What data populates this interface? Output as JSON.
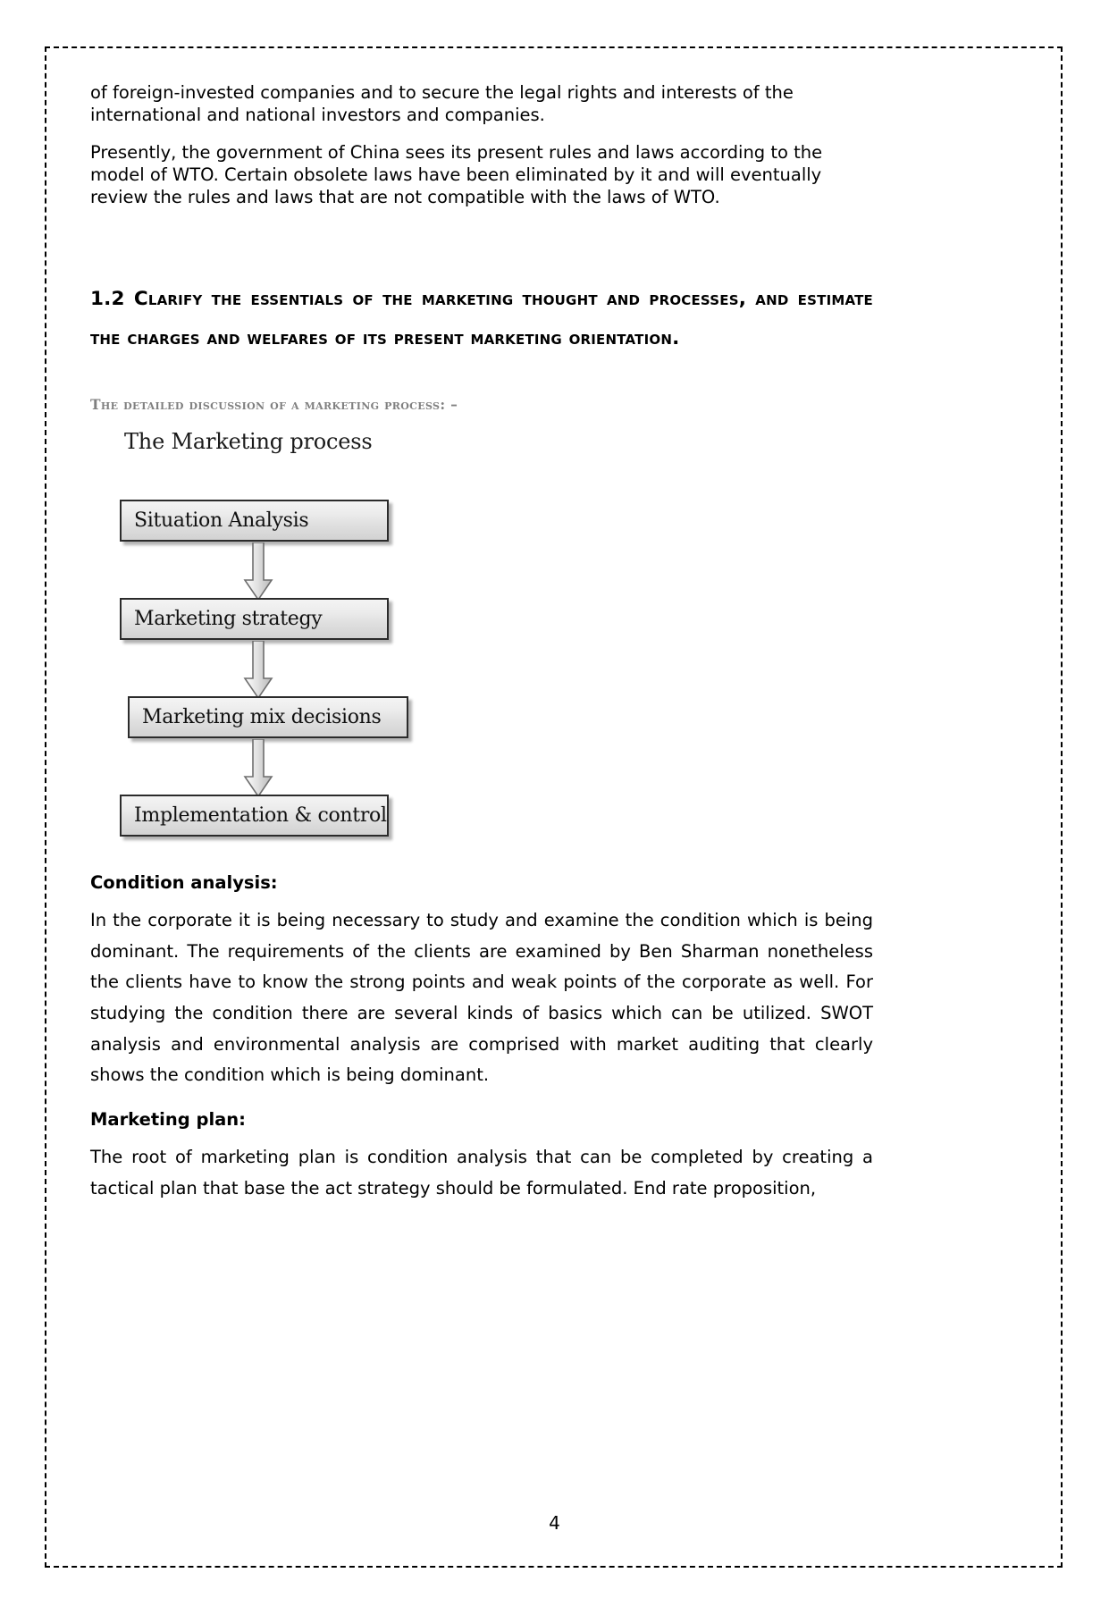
{
  "document": {
    "page_number": "4",
    "border_style": "dashed"
  },
  "paragraphs": {
    "p1": "of foreign-invested companies and to secure the legal rights and interests of the international and national investors and companies.",
    "p2": "Presently, the government of China sees its present rules and laws according to the model of WTO. Certain obsolete laws have been eliminated by it and will eventually review the rules and laws that are not compatible with the laws of WTO."
  },
  "section_heading": {
    "number": "1.2",
    "text": "Clarify the essentials of the marketing thought and processes, and estimate the charges and welfares of its present marketing orientation."
  },
  "sub_heading": {
    "text": "The detailed discussion of a marketing process: –",
    "color": "#808080"
  },
  "diagram": {
    "title": "The Marketing process",
    "boxes": [
      {
        "label": "Situation Analysis"
      },
      {
        "label": "Marketing strategy"
      },
      {
        "label": "Marketing mix decisions"
      },
      {
        "label": "Implementation & control"
      }
    ],
    "arrow_icon": "down-arrow-icon",
    "border_color": "#2b2b2b",
    "fill_top": "#f4f4f4",
    "fill_bottom": "#d2d2d2"
  },
  "sections": [
    {
      "heading": "Condition analysis:",
      "body": "In the corporate it is being necessary to study and examine the condition which is being dominant. The requirements of the clients are examined by Ben Sharman nonetheless the clients have to know the strong points and weak points of the corporate as well. For studying the condition there are several kinds of basics which can be utilized. SWOT analysis and environmental analysis are comprised with market auditing that clearly shows the condition which is being dominant."
    },
    {
      "heading": "Marketing plan:",
      "body": "The root of marketing plan is condition analysis that can be completed by creating a tactical plan that base the act strategy should be formulated. End rate proposition,"
    }
  ]
}
